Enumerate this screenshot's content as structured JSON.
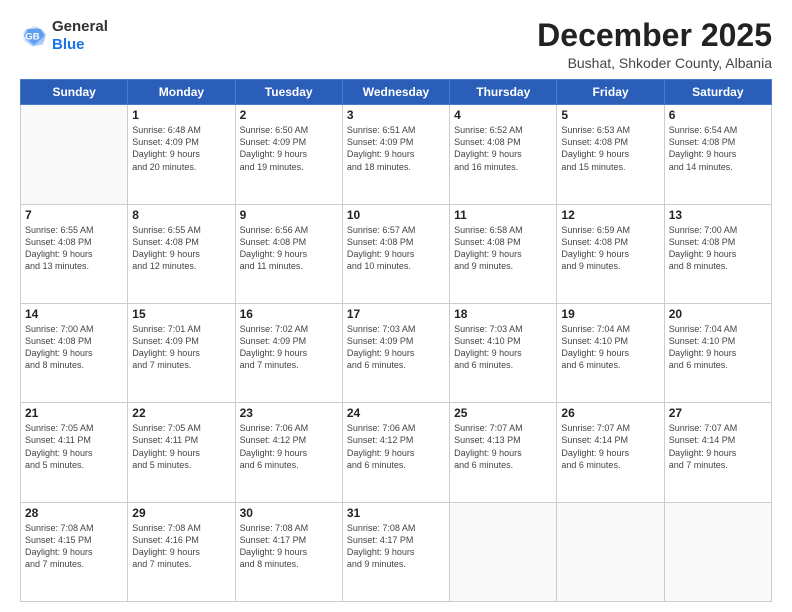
{
  "logo": {
    "line1": "General",
    "line2": "Blue"
  },
  "header": {
    "title": "December 2025",
    "subtitle": "Bushat, Shkoder County, Albania"
  },
  "weekdays": [
    "Sunday",
    "Monday",
    "Tuesday",
    "Wednesday",
    "Thursday",
    "Friday",
    "Saturday"
  ],
  "weeks": [
    [
      {
        "day": "",
        "info": ""
      },
      {
        "day": "1",
        "info": "Sunrise: 6:48 AM\nSunset: 4:09 PM\nDaylight: 9 hours\nand 20 minutes."
      },
      {
        "day": "2",
        "info": "Sunrise: 6:50 AM\nSunset: 4:09 PM\nDaylight: 9 hours\nand 19 minutes."
      },
      {
        "day": "3",
        "info": "Sunrise: 6:51 AM\nSunset: 4:09 PM\nDaylight: 9 hours\nand 18 minutes."
      },
      {
        "day": "4",
        "info": "Sunrise: 6:52 AM\nSunset: 4:08 PM\nDaylight: 9 hours\nand 16 minutes."
      },
      {
        "day": "5",
        "info": "Sunrise: 6:53 AM\nSunset: 4:08 PM\nDaylight: 9 hours\nand 15 minutes."
      },
      {
        "day": "6",
        "info": "Sunrise: 6:54 AM\nSunset: 4:08 PM\nDaylight: 9 hours\nand 14 minutes."
      }
    ],
    [
      {
        "day": "7",
        "info": "Sunrise: 6:55 AM\nSunset: 4:08 PM\nDaylight: 9 hours\nand 13 minutes."
      },
      {
        "day": "8",
        "info": "Sunrise: 6:55 AM\nSunset: 4:08 PM\nDaylight: 9 hours\nand 12 minutes."
      },
      {
        "day": "9",
        "info": "Sunrise: 6:56 AM\nSunset: 4:08 PM\nDaylight: 9 hours\nand 11 minutes."
      },
      {
        "day": "10",
        "info": "Sunrise: 6:57 AM\nSunset: 4:08 PM\nDaylight: 9 hours\nand 10 minutes."
      },
      {
        "day": "11",
        "info": "Sunrise: 6:58 AM\nSunset: 4:08 PM\nDaylight: 9 hours\nand 9 minutes."
      },
      {
        "day": "12",
        "info": "Sunrise: 6:59 AM\nSunset: 4:08 PM\nDaylight: 9 hours\nand 9 minutes."
      },
      {
        "day": "13",
        "info": "Sunrise: 7:00 AM\nSunset: 4:08 PM\nDaylight: 9 hours\nand 8 minutes."
      }
    ],
    [
      {
        "day": "14",
        "info": "Sunrise: 7:00 AM\nSunset: 4:08 PM\nDaylight: 9 hours\nand 8 minutes."
      },
      {
        "day": "15",
        "info": "Sunrise: 7:01 AM\nSunset: 4:09 PM\nDaylight: 9 hours\nand 7 minutes."
      },
      {
        "day": "16",
        "info": "Sunrise: 7:02 AM\nSunset: 4:09 PM\nDaylight: 9 hours\nand 7 minutes."
      },
      {
        "day": "17",
        "info": "Sunrise: 7:03 AM\nSunset: 4:09 PM\nDaylight: 9 hours\nand 6 minutes."
      },
      {
        "day": "18",
        "info": "Sunrise: 7:03 AM\nSunset: 4:10 PM\nDaylight: 9 hours\nand 6 minutes."
      },
      {
        "day": "19",
        "info": "Sunrise: 7:04 AM\nSunset: 4:10 PM\nDaylight: 9 hours\nand 6 minutes."
      },
      {
        "day": "20",
        "info": "Sunrise: 7:04 AM\nSunset: 4:10 PM\nDaylight: 9 hours\nand 6 minutes."
      }
    ],
    [
      {
        "day": "21",
        "info": "Sunrise: 7:05 AM\nSunset: 4:11 PM\nDaylight: 9 hours\nand 5 minutes."
      },
      {
        "day": "22",
        "info": "Sunrise: 7:05 AM\nSunset: 4:11 PM\nDaylight: 9 hours\nand 5 minutes."
      },
      {
        "day": "23",
        "info": "Sunrise: 7:06 AM\nSunset: 4:12 PM\nDaylight: 9 hours\nand 6 minutes."
      },
      {
        "day": "24",
        "info": "Sunrise: 7:06 AM\nSunset: 4:12 PM\nDaylight: 9 hours\nand 6 minutes."
      },
      {
        "day": "25",
        "info": "Sunrise: 7:07 AM\nSunset: 4:13 PM\nDaylight: 9 hours\nand 6 minutes."
      },
      {
        "day": "26",
        "info": "Sunrise: 7:07 AM\nSunset: 4:14 PM\nDaylight: 9 hours\nand 6 minutes."
      },
      {
        "day": "27",
        "info": "Sunrise: 7:07 AM\nSunset: 4:14 PM\nDaylight: 9 hours\nand 7 minutes."
      }
    ],
    [
      {
        "day": "28",
        "info": "Sunrise: 7:08 AM\nSunset: 4:15 PM\nDaylight: 9 hours\nand 7 minutes."
      },
      {
        "day": "29",
        "info": "Sunrise: 7:08 AM\nSunset: 4:16 PM\nDaylight: 9 hours\nand 7 minutes."
      },
      {
        "day": "30",
        "info": "Sunrise: 7:08 AM\nSunset: 4:17 PM\nDaylight: 9 hours\nand 8 minutes."
      },
      {
        "day": "31",
        "info": "Sunrise: 7:08 AM\nSunset: 4:17 PM\nDaylight: 9 hours\nand 9 minutes."
      },
      {
        "day": "",
        "info": ""
      },
      {
        "day": "",
        "info": ""
      },
      {
        "day": "",
        "info": ""
      }
    ]
  ]
}
